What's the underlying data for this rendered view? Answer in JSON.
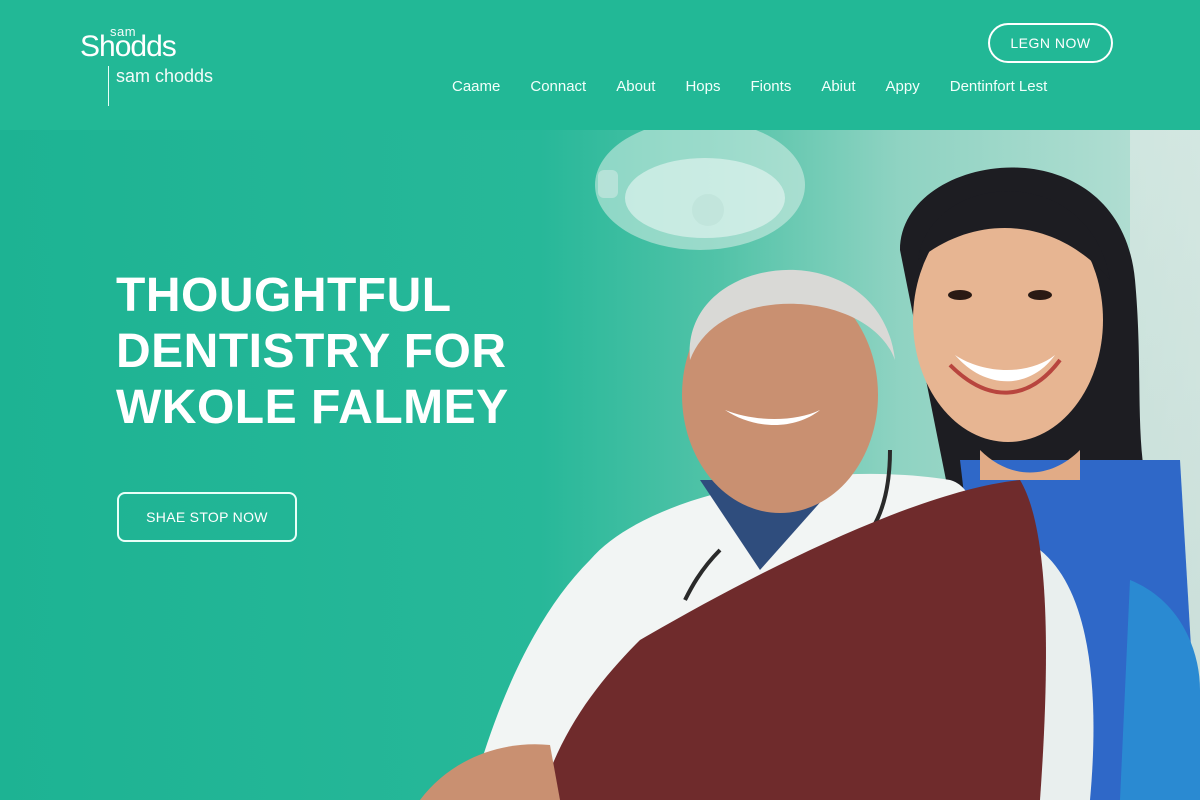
{
  "header": {
    "logo_small": "sam",
    "logo_big": "Shodds",
    "logo_sub": "sam chodds",
    "cta_label": "LEGN NOW",
    "nav": [
      {
        "label": "Caame"
      },
      {
        "label": "Connact"
      },
      {
        "label": "About"
      },
      {
        "label": "Hops"
      },
      {
        "label": "Fionts"
      },
      {
        "label": "Abiut"
      },
      {
        "label": "Appy"
      },
      {
        "label": "Dentinfort Lest"
      }
    ]
  },
  "hero": {
    "title_lines": [
      "THOUGHTFUL",
      "DENTISTRY FOR",
      "WKOLE FALMEY"
    ],
    "button_label": "SHAE STOP NOW"
  },
  "colors": {
    "brand": "#22b896",
    "hero_bg": "#1db393",
    "text": "#ffffff"
  }
}
